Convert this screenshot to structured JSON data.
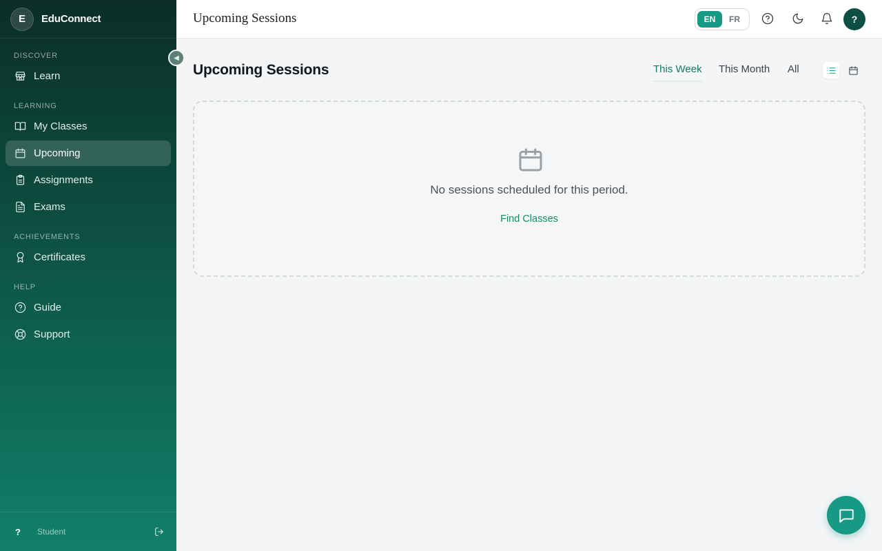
{
  "brand": {
    "initial": "E",
    "name": "EduConnect"
  },
  "sidebar": {
    "sections": [
      {
        "label": "DISCOVER",
        "items": [
          {
            "label": "Learn",
            "icon": "store-icon"
          }
        ]
      },
      {
        "label": "LEARNING",
        "items": [
          {
            "label": "My Classes",
            "icon": "book-icon"
          },
          {
            "label": "Upcoming",
            "icon": "calendar-icon",
            "active": true
          },
          {
            "label": "Assignments",
            "icon": "clipboard-icon"
          },
          {
            "label": "Exams",
            "icon": "document-icon"
          }
        ]
      },
      {
        "label": "ACHIEVEMENTS",
        "items": [
          {
            "label": "Certificates",
            "icon": "award-icon"
          }
        ]
      },
      {
        "label": "HELP",
        "items": [
          {
            "label": "Guide",
            "icon": "help-circle-icon"
          },
          {
            "label": "Support",
            "icon": "lifebuoy-icon"
          }
        ]
      }
    ],
    "footer": {
      "avatar": "?",
      "role": "Student"
    }
  },
  "topbar": {
    "title": "Upcoming Sessions",
    "languages": [
      {
        "code": "EN",
        "active": true
      },
      {
        "code": "FR",
        "active": false
      }
    ],
    "avatar": "?"
  },
  "main": {
    "title": "Upcoming Sessions",
    "filters": [
      {
        "label": "This Week",
        "active": true
      },
      {
        "label": "This Month"
      },
      {
        "label": "All"
      }
    ],
    "empty_state": {
      "message": "No sessions scheduled for this period.",
      "action": "Find Classes"
    }
  },
  "colors": {
    "accent": "#169a85",
    "link": "#158a66",
    "sidebar_top": "#0b2e26",
    "sidebar_bottom": "#12806a"
  }
}
